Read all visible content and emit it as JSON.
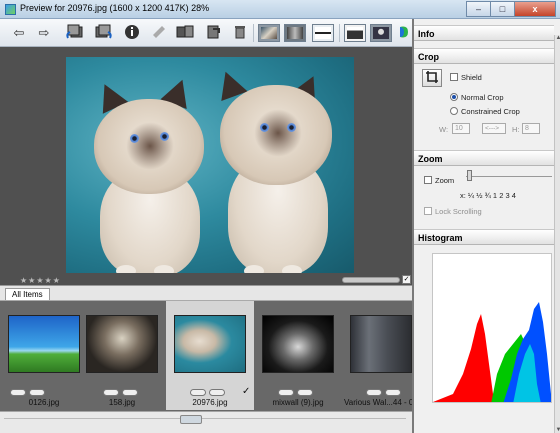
{
  "window": {
    "title": "Preview for 20976.jpg (1600 x 1200 417K) 28%",
    "minimize": "–",
    "maximize": "□",
    "close": "x"
  },
  "toolbar": {
    "back_icon": "⇦",
    "forward_icon": "⇨",
    "icons": [
      "rotate-left-icon",
      "rotate-right-icon",
      "info-icon",
      "edit-icon",
      "compare-icon",
      "save-icon",
      "trash-icon",
      "view-single-icon",
      "view-split-icon",
      "view-film-icon",
      "view-fullscreen-icon",
      "view-person-icon"
    ]
  },
  "preview": {
    "rating_stars": "★★★★★",
    "checkbox": "✓"
  },
  "tabs": {
    "all_items": "All Items"
  },
  "filmstrip": {
    "items": [
      {
        "name": "0126.jpg",
        "check": ""
      },
      {
        "name": "158.jpg",
        "check": ""
      },
      {
        "name": "20976.jpg",
        "check": "✓"
      },
      {
        "name": "mixwall (9).jpg",
        "check": ""
      },
      {
        "name": "Various Wal...44 - 00",
        "check": ""
      }
    ]
  },
  "panel": {
    "info": "Info",
    "crop": "Crop",
    "shield": "Shield",
    "normal_crop": "Normal Crop",
    "constrained_crop": "Constrained Crop",
    "w_label": "W:",
    "w_value": "10",
    "swap": "<--->",
    "h_label": "H:",
    "h_value": "8",
    "zoom": "Zoom",
    "zoom_check": "Zoom",
    "zoom_levels": "x:  ¼   ½   ¾   1   2   3   4",
    "lock_scrolling": "Lock Scrolling",
    "histogram": "Histogram"
  },
  "colors": {
    "hist_red": "#ff0000",
    "hist_green": "#00c800",
    "hist_blue": "#0050ff",
    "hist_cyan": "#00d8e0"
  }
}
